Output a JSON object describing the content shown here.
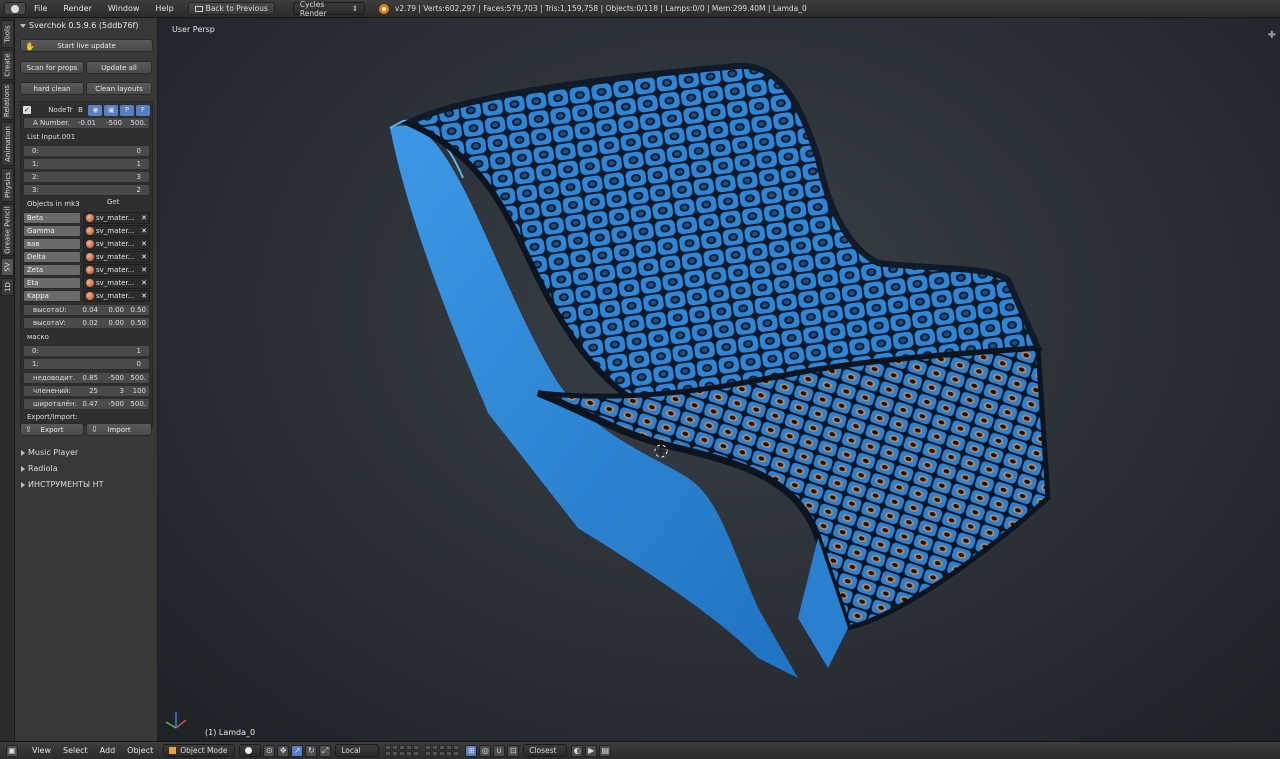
{
  "topbar": {
    "menus": [
      "File",
      "Render",
      "Window",
      "Help"
    ],
    "back_button": "Back to Previous",
    "render_engine": "Cycles Render",
    "stats": "v2.79 | Verts:602,297 | Faces:579,703 | Tris:1,159,758 | Objects:0/118 | Lamps:0/0 | Mem:299.40M | Lamda_0"
  },
  "vtabs": [
    "Tools",
    "Create",
    "Relations",
    "Animation",
    "Physics",
    "Grease Pencil",
    "SV",
    "1D"
  ],
  "panel": {
    "header": "Sverchok 0.5.9.6 (5ddb76f)",
    "start_live_update": "Start live update",
    "scan_for_props": "Scan for props",
    "update_all": "Update all",
    "hard_clean": "hard clean",
    "clean_layouts": "Clean layouts",
    "node_tree": {
      "name": "NodeTr",
      "buttons": [
        "B",
        "P",
        "F"
      ]
    },
    "a_number": {
      "label": "A Number.",
      "value": "-0.01",
      "min": "-500",
      "max": "500."
    },
    "list_input": {
      "title": "List Input.001",
      "items": [
        {
          "label": "0:",
          "value": "0"
        },
        {
          "label": "1:",
          "value": "1"
        },
        {
          "label": "2:",
          "value": "3"
        },
        {
          "label": "3:",
          "value": "2"
        }
      ]
    },
    "objects_in": {
      "title": "Objects in mk3",
      "get": "Get",
      "items": [
        {
          "name": "Beta",
          "material": "sv_mater..."
        },
        {
          "name": "Gamma",
          "material": "sv_mater..."
        },
        {
          "name": "вав",
          "material": "sv_mater..."
        },
        {
          "name": "Delta",
          "material": "sv_mater..."
        },
        {
          "name": "Zeta",
          "material": "sv_mater..."
        },
        {
          "name": "Eta",
          "material": "sv_mater..."
        },
        {
          "name": "Kappa",
          "material": "sv_mater..."
        }
      ]
    },
    "height_u": {
      "label": "высотаU:",
      "value": "0.04",
      "min": "0.00",
      "max": "0.50"
    },
    "height_v": {
      "label": "высотаV:",
      "value": "0.02",
      "min": "0.00",
      "max": "0.50"
    },
    "mask": {
      "title": "маско",
      "items": [
        {
          "label": "0:",
          "value": "1"
        },
        {
          "label": "1:",
          "value": "0"
        }
      ]
    },
    "nedovodit": {
      "label": "недоводит.",
      "value": "0.85",
      "min": "-500",
      "max": "500."
    },
    "chlenenii": {
      "label": "членений:",
      "value": "25",
      "min": "3",
      "max": "100"
    },
    "shirotalen": {
      "label": "широталён:",
      "value": "0.47",
      "min": "-500",
      "max": "500."
    },
    "export_import_label": "Export/Import:",
    "export": "Export",
    "import": "Import",
    "collapsed": [
      "Music Player",
      "Radiola",
      "ИНСТРУМЕНТЫ НТ"
    ]
  },
  "viewport": {
    "view_label": "User Persp",
    "object_label": "(1) Lamda_0"
  },
  "bottombar": {
    "menus": [
      "View",
      "Select",
      "Add",
      "Object"
    ],
    "mode": "Object Mode",
    "pivot": "Local",
    "snap": "Closest"
  },
  "colors": {
    "bench_blue": "#2f86d6",
    "accent_blue": "#5680c2",
    "orange_fill": "#c9854f"
  }
}
